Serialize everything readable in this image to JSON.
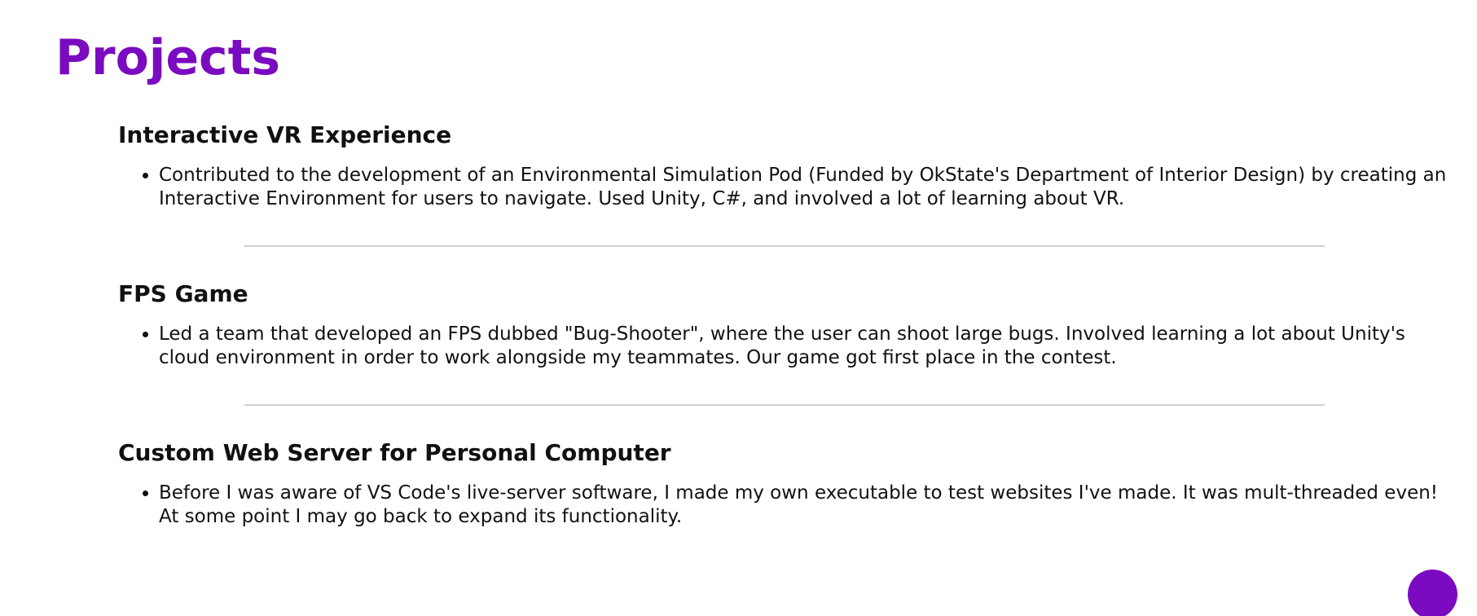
{
  "colors": {
    "accent": "#7a0bc0",
    "divider": "#cfcfcf",
    "text": "#111111"
  },
  "page_title": "Projects",
  "projects": [
    {
      "title": "Interactive VR Experience",
      "bullets": [
        "Contributed to the development of an Environmental Simulation Pod (Funded by OkState's Department of Interior Design) by creating an Interactive Environment for users to navigate. Used Unity, C#, and involved a lot of learning about VR."
      ]
    },
    {
      "title": "FPS Game",
      "bullets": [
        "Led a team that developed an FPS dubbed \"Bug-Shooter\", where the user can shoot large bugs. Involved learning a lot about Unity's cloud environment in order to work alongside my teammates. Our game got first place in the contest."
      ]
    },
    {
      "title": "Custom Web Server for Personal Computer",
      "bullets": [
        "Before I was aware of VS Code's live-server software, I made my own executable to test websites I've made. It was mult-threaded even! At some point I may go back to expand its functionality."
      ]
    }
  ],
  "floating_button": {
    "icon": "circle-button-icon"
  }
}
